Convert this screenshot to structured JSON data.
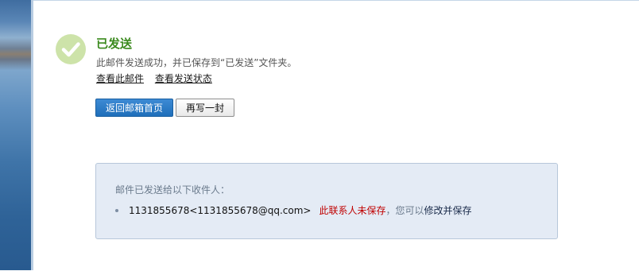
{
  "status": {
    "title": "已发送",
    "description": "此邮件发送成功，并已保存到“已发送”文件夹。"
  },
  "links": {
    "view_mail": "查看此邮件",
    "view_status": "查看发送状态"
  },
  "buttons": {
    "back_home": "返回邮箱首页",
    "write_again": "再写一封"
  },
  "recipients": {
    "heading": "邮件已发送给以下收件人：",
    "items": [
      {
        "address": "1131855678<1131855678@qq.com>",
        "unsaved_note": "此联系人未保存",
        "hint": "，您可以",
        "save_action": "修改并保存"
      }
    ]
  },
  "colors": {
    "success_green": "#3b8a1e",
    "primary_blue": "#1f6fba",
    "warning_red": "#c00000",
    "box_bg": "#e4ebf5"
  },
  "icons": {
    "status": "check-circle-icon",
    "bullet": "bullet-icon"
  }
}
